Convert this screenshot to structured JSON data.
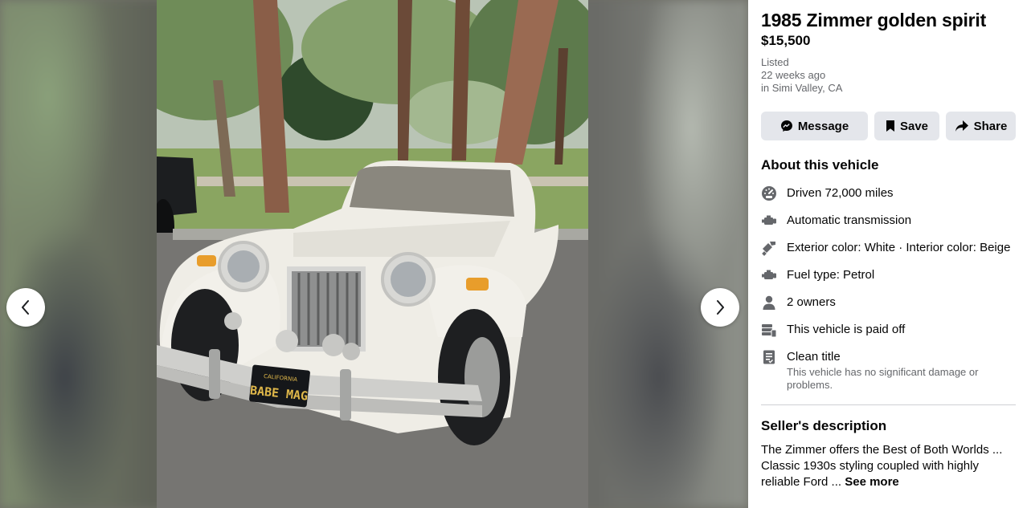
{
  "listing": {
    "title": "1985 Zimmer golden spirit",
    "price": "$15,500",
    "listed_label": "Listed",
    "listed_time": "22 weeks ago",
    "location": "in Simi Valley, CA"
  },
  "actions": {
    "message_label": "Message",
    "save_label": "Save",
    "share_label": "Share"
  },
  "about": {
    "title": "About this vehicle",
    "items": [
      {
        "icon": "speedometer-icon",
        "text": "Driven 72,000 miles"
      },
      {
        "icon": "engine-icon",
        "text": "Automatic transmission"
      },
      {
        "icon": "paint-brush-icon",
        "text": "Exterior color: White · Interior color: Beige"
      },
      {
        "icon": "engine-icon",
        "text": "Fuel type: Petrol"
      },
      {
        "icon": "person-icon",
        "text": "2 owners"
      },
      {
        "icon": "money-stack-icon",
        "text": "This vehicle is paid off"
      },
      {
        "icon": "title-document-icon",
        "text": "Clean title",
        "sub": "This vehicle has no significant damage or problems."
      }
    ]
  },
  "seller": {
    "title": "Seller's description",
    "text": "The Zimmer offers the Best of Both Worlds ... Classic 1930s styling coupled with highly reliable Ford ... ",
    "see_more": "See more"
  },
  "photo": {
    "plate_state": "CALIFORNIA",
    "plate_text": "BABE MAG"
  },
  "colors": {
    "button_bg": "#e4e6eb",
    "secondary_text": "#65676b",
    "icon_gray": "#65676b"
  }
}
